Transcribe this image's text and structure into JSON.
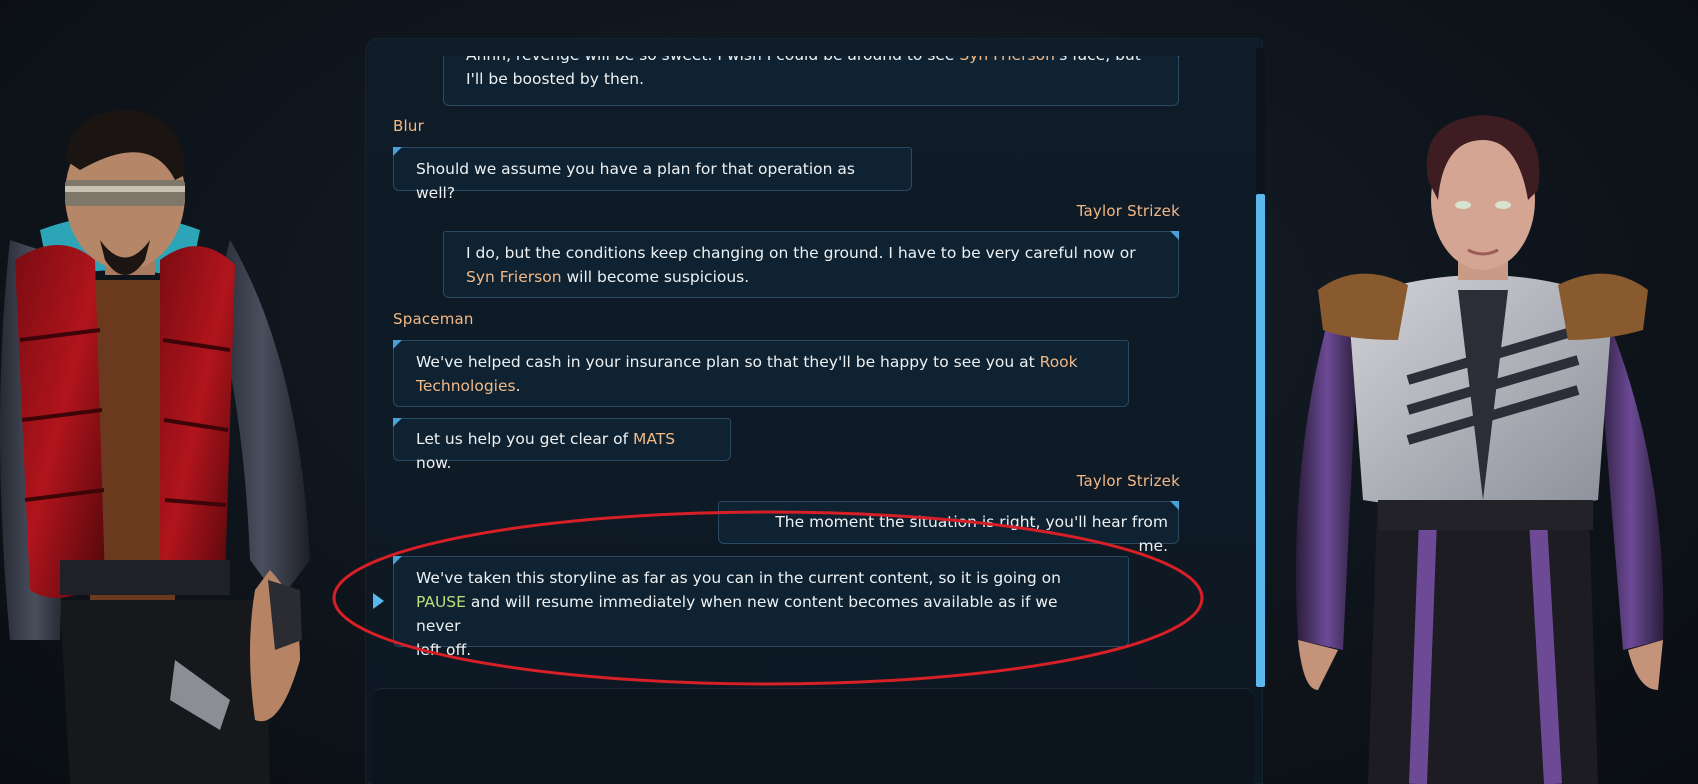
{
  "dialog": {
    "messages": [
      {
        "speaker": "",
        "side": "right",
        "parts": [
          "Ahhh, revenge will be so sweet. I wish I could be around to see ",
          "Syn Frierson",
          "'s face, but",
          "I'll be boosted by then."
        ]
      },
      {
        "speaker": "Blur",
        "side": "left",
        "parts": [
          "Should we assume you have a plan for that operation as well?"
        ]
      },
      {
        "speaker": "Taylor Strizek",
        "side": "right",
        "parts": [
          "I do, but the conditions keep changing on the ground. I have to be very careful now or",
          "Syn Frierson",
          " will become suspicious."
        ]
      },
      {
        "speaker": "Spaceman",
        "side": "left",
        "parts": [
          "We've helped cash in your insurance plan so that they'll be happy to see you at ",
          "Rook",
          "Technologies",
          "."
        ]
      },
      {
        "speaker": "",
        "side": "left",
        "parts": [
          "Let us help you get clear of ",
          "MATS",
          " now."
        ]
      },
      {
        "speaker": "Taylor Strizek",
        "side": "right",
        "parts": [
          "The moment the situation is right, you'll hear from me."
        ]
      },
      {
        "speaker": "",
        "side": "left",
        "parts": [
          "We've taken this storyline as far as you can in the current content, so it is going on",
          "PAUSE",
          " and will resume immediately when new content becomes available as if we never",
          "left off."
        ]
      }
    ]
  },
  "colors": {
    "speaker": "#f2b887",
    "highlight": "#f2b887",
    "pause": "#b9e07a",
    "accent": "#5bb8ec",
    "annotation": "#d61f26"
  },
  "icons": {
    "current_line_marker": "play-triangle-icon"
  }
}
